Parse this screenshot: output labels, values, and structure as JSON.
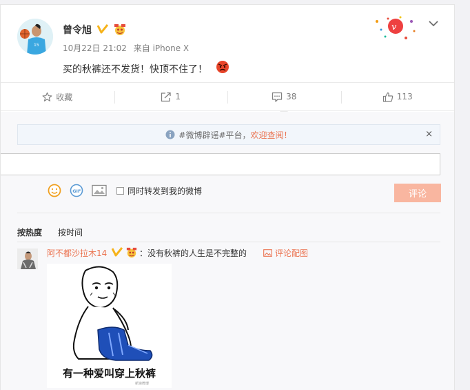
{
  "post": {
    "username": "曾令旭",
    "date": "10月22日 21:02",
    "source": "来自 iPhone X",
    "text": "买的秋裤还不发货！快顶不住了！"
  },
  "actions": {
    "favorite": "收藏",
    "repost": "1",
    "comment": "38",
    "like": "113"
  },
  "comment_area": {
    "notice_prefix": "#微博辟谣#平台，",
    "notice_link": "欢迎查阅！",
    "notice_close": "×",
    "input_value": "",
    "repost_checkbox_label": "同时转发到我的微博",
    "submit_label": "评论",
    "sort": [
      "按热度",
      "按时间"
    ]
  },
  "comments": [
    {
      "user": "阿不都沙拉木14",
      "text": "：没有秋裤的人生是不完整的",
      "picture_link": "评论配图",
      "image_caption": "有一种爱叫穿上秋裤",
      "image_watermark": "新浪微博"
    }
  ],
  "colors": {
    "accent": "#eb7350",
    "submit_disabled": "#f9b6a0",
    "verified_badge": "#f6b31b",
    "background": "#f2f2f5"
  },
  "icons": [
    "star-icon",
    "share-icon",
    "comment-icon",
    "like-icon",
    "chevron-down-icon",
    "info-icon",
    "close-icon",
    "emoji-icon",
    "gif-icon",
    "image-icon",
    "picture-icon"
  ]
}
